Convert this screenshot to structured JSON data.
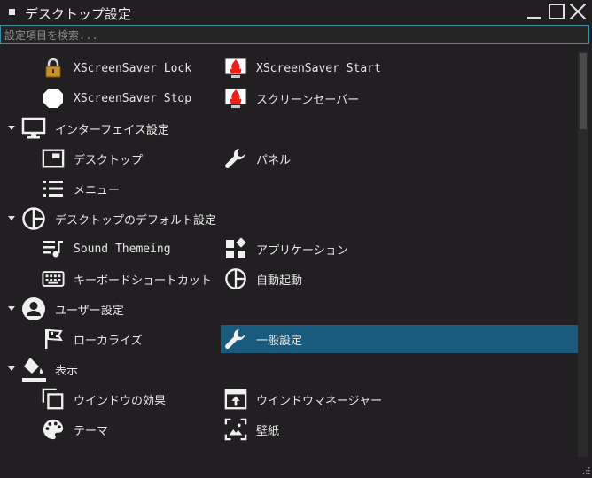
{
  "window": {
    "title": "デスクトップ設定",
    "buttons": {
      "minimize": "minimize-icon",
      "maximize": "maximize-icon",
      "close": "close-icon"
    }
  },
  "search": {
    "placeholder": "設定項目を検索..."
  },
  "categories": [
    {
      "label": "インターフェイス設定",
      "icon": "monitor-icon"
    },
    {
      "label": "デスクトップのデフォルト設定",
      "icon": "pie-icon"
    },
    {
      "label": "ユーザー設定",
      "icon": "user-icon"
    },
    {
      "label": "表示",
      "icon": "paint-bucket-icon"
    }
  ],
  "items": {
    "xscreensaver_lock": "XScreenSaver Lock",
    "xscreensaver_start": "XScreenSaver Start",
    "xscreensaver_stop": "XScreenSaver Stop",
    "screensaver": "スクリーンセーバー",
    "desktop": "デスクトップ",
    "panel": "パネル",
    "menu": "メニュー",
    "sound_theming": "Sound Themeing",
    "applications": "アプリケーション",
    "keyboard_shortcuts": "キーボードショートカット",
    "autostart": "自動起動",
    "localize": "ローカライズ",
    "general": "一般設定",
    "window_effects": "ウインドウの効果",
    "window_manager": "ウインドウマネージャー",
    "theme": "テーマ",
    "wallpaper": "壁紙"
  },
  "selected_item": "一般設定",
  "colors": {
    "background": "#221f22",
    "selection": "#1a5a7c",
    "search_border": "#3e8ea8",
    "flame": "#e8231a"
  }
}
